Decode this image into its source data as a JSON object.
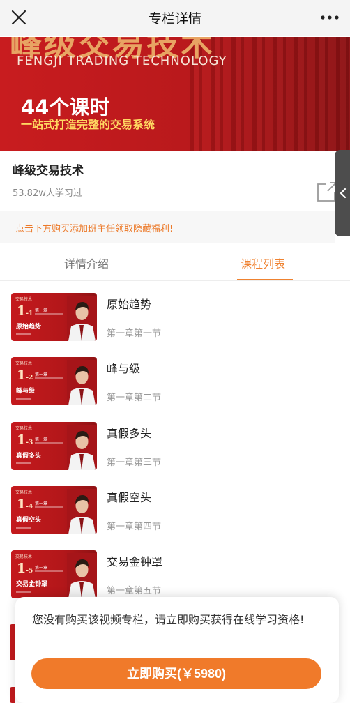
{
  "nav": {
    "title": "专栏详情"
  },
  "banner": {
    "big_title": "峰级交易技术",
    "english": "FENGJI TRADING TECHNOLOGY",
    "hours": "44个课时",
    "subtitle": "一站式打造完整的交易系统"
  },
  "course": {
    "title": "峰级交易技术",
    "learners": "53.82w人学习过"
  },
  "promo": "点击下方购买添加班主任领取隐藏福利!",
  "tabs": [
    {
      "label": "详情介绍",
      "active": false
    },
    {
      "label": "课程列表",
      "active": true
    }
  ],
  "lessons": [
    {
      "num": "1",
      "sub_num": "1",
      "chapter_tag": "第一章",
      "label": "原始趋势",
      "title": "原始趋势",
      "subtitle": "第一章第一节"
    },
    {
      "num": "1",
      "sub_num": "2",
      "chapter_tag": "第一章",
      "label": "峰与级",
      "title": "峰与级",
      "subtitle": "第一章第二节"
    },
    {
      "num": "1",
      "sub_num": "3",
      "chapter_tag": "第一章",
      "label": "真假多头",
      "title": "真假多头",
      "subtitle": "第一章第三节"
    },
    {
      "num": "1",
      "sub_num": "4",
      "chapter_tag": "第一章",
      "label": "真假空头",
      "title": "真假空头",
      "subtitle": "第一章第四节"
    },
    {
      "num": "1",
      "sub_num": "5",
      "chapter_tag": "第一章",
      "label": "交易金钟罩",
      "title": "交易金钟罩",
      "subtitle": "第一章第五节"
    }
  ],
  "thumb_brand": "交易技术",
  "purchase": {
    "message": "您没有购买该视频专栏，请立即购买获得在线学习资格!",
    "button": "立即购买(￥5980)"
  },
  "colors": {
    "accent": "#ef8230",
    "banner_red": "#c81c1f",
    "button": "#f07a2a"
  }
}
